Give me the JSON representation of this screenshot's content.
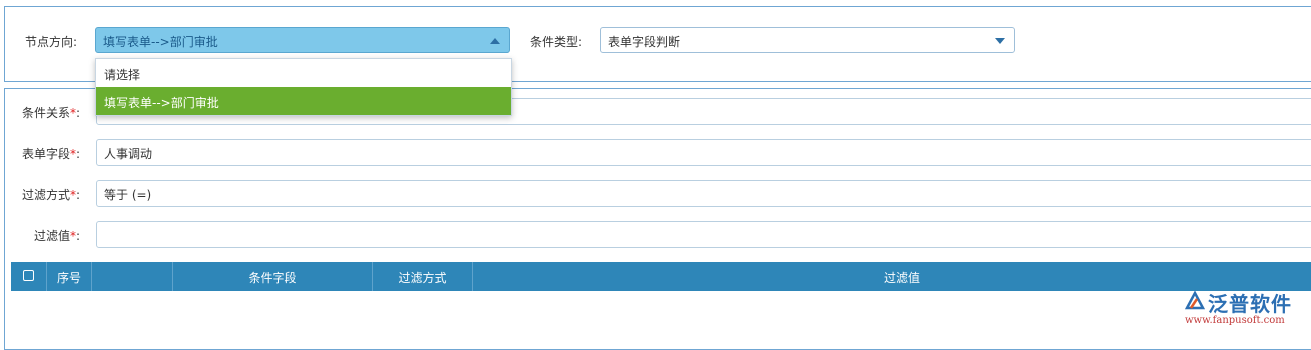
{
  "top": {
    "direction_label": "节点方向:",
    "direction_value": "填写表单-->部门审批",
    "condition_type_label": "条件类型:",
    "condition_type_value": "表单字段判断"
  },
  "dropdown": {
    "options": [
      {
        "label": "请选择",
        "selected": false
      },
      {
        "label": "填写表单-->部门审批",
        "selected": true
      }
    ]
  },
  "form": {
    "relation_label": "条件关系",
    "field_label": "表单字段",
    "field_value": "人事调动",
    "filter_mode_label": "过滤方式",
    "filter_mode_value": "等于 (=)",
    "filter_value_label": "过滤值",
    "filter_value_value": "",
    "required_mark": "*",
    "colon": ":"
  },
  "table": {
    "columns": [
      "序号",
      "",
      "条件字段",
      "过滤方式",
      "过滤值"
    ]
  },
  "logo": {
    "name": "泛普软件",
    "url": "www.fanpusoft.com"
  },
  "colors": {
    "header_bg": "#2e86b8",
    "active_select": "#7ec8ea",
    "selected_option": "#6aae2f",
    "required": "#e02020",
    "border": "#6fa6d3"
  }
}
